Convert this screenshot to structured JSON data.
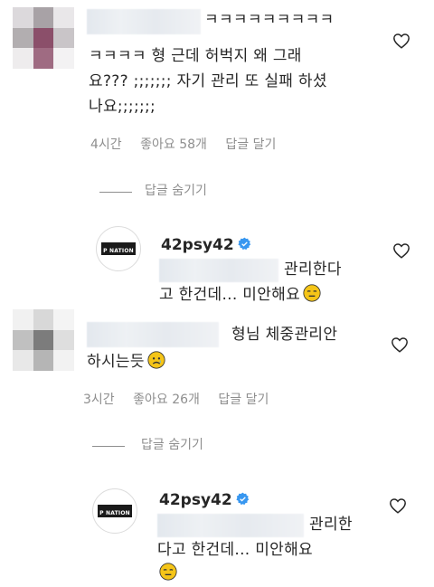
{
  "comments": [
    {
      "text_line1": "ㅋㅋㅋㅋㅋㅋㅋㅋㅋ",
      "text_line2": "ㅋㅋㅋㅋ 형 근데 허벅지 왜 그래",
      "text_line3": "요??? ;;;;;;; 자기 관리 또 실패 하셨",
      "text_line4": "나요;;;;;;;",
      "time": "4시간",
      "likes": "좋아요 58개",
      "reply_label": "답글 달기",
      "hide_replies": "답글 숨기기",
      "reply": {
        "username": "42psy42",
        "text_line1": "관리한다",
        "text_line2": "고 한건데... 미안해요",
        "emoji": "pensive-face"
      }
    },
    {
      "text_line1": "형님 체중관리안",
      "text_line2": "하시는듯",
      "emoji": "sad-face",
      "time": "3시간",
      "likes": "좋아요 26개",
      "reply_label": "답글 달기",
      "hide_replies": "답글 숨기기",
      "reply": {
        "username": "42psy42",
        "text_line1": "관리한",
        "text_line2": "다고 한건데... 미안해요",
        "emoji": "pensive-face"
      }
    }
  ],
  "brand_logo_text": "P NATION",
  "colors": {
    "text": "#262626",
    "muted": "#8e8e8e",
    "verified": "#3897f0",
    "emoji": "#f5c518"
  }
}
